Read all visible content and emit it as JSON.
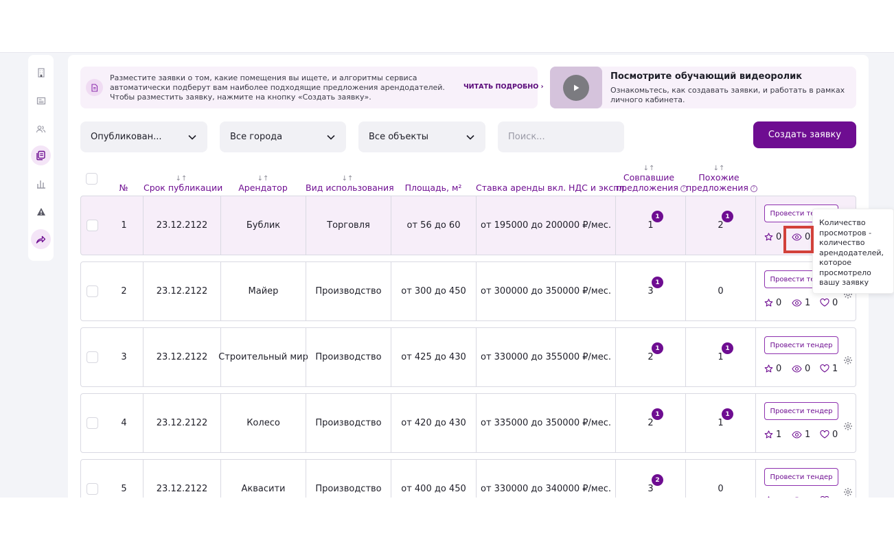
{
  "banner": {
    "text": "Разместите заявки о том, какие помещения вы ищете, и алгоритмы сервиса автоматически подберут вам наиболее подходящие предложения арендодателей. Чтобы разместить заявку, нажмите на кнопку «Создать заявку».",
    "link": "ЧИТАТЬ ПОДРОБНО ›"
  },
  "video": {
    "title": "Посмотрите обучающий видеоролик",
    "description": "Ознакомьтесь, как создавать заявки, и работать в рамках личного кабинета."
  },
  "filters": {
    "status": "Опубликован...",
    "city": "Все города",
    "object": "Все объекты",
    "search_placeholder": "Поиск...",
    "create_label": "Создать заявку"
  },
  "table": {
    "headers": {
      "num": "№",
      "period": "Срок публикации",
      "tenant": "Арендатор",
      "usage": "Вид использования",
      "area": "Площадь, м²",
      "rate": "Ставка аренды вкл. НДС и экспл.",
      "matched_1": "Совпавшие",
      "matched_2": "предложения",
      "similar_1": "Похожие",
      "similar_2": "предложения"
    },
    "sort_glyph": "↓↑",
    "help_glyph": "?",
    "tender_label": "Провести тендер",
    "rows": [
      {
        "num": "1",
        "date": "23.12.2122",
        "tenant": "Бублик",
        "usage": "Торговля",
        "area": "от 56 до 60",
        "rate": "от 195000 до 200000 ₽/мес.",
        "matched": "1",
        "matched_badge": "1",
        "similar": "2",
        "similar_badge": "1",
        "stars": "0",
        "views": "0",
        "likes": ""
      },
      {
        "num": "2",
        "date": "23.12.2122",
        "tenant": "Майер",
        "usage": "Производство",
        "area": "от 300 до 450",
        "rate": "от 300000 до 350000 ₽/мес.",
        "matched": "3",
        "matched_badge": "1",
        "similar": "0",
        "similar_badge": "",
        "stars": "0",
        "views": "1",
        "likes": "0"
      },
      {
        "num": "3",
        "date": "23.12.2122",
        "tenant": "Строительный мир",
        "usage": "Производство",
        "area": "от 425 до 430",
        "rate": "от 330000 до 355000 ₽/мес.",
        "matched": "2",
        "matched_badge": "1",
        "similar": "1",
        "similar_badge": "1",
        "stars": "0",
        "views": "0",
        "likes": "1"
      },
      {
        "num": "4",
        "date": "23.12.2122",
        "tenant": "Колесо",
        "usage": "Производство",
        "area": "от 420 до 430",
        "rate": "от 335000 до 350000 ₽/мес.",
        "matched": "2",
        "matched_badge": "1",
        "similar": "1",
        "similar_badge": "1",
        "stars": "1",
        "views": "1",
        "likes": "0"
      },
      {
        "num": "5",
        "date": "23.12.2122",
        "tenant": "Аквасити",
        "usage": "Производство",
        "area": "от 400 до 450",
        "rate": "от 330000 до 340000 ₽/мес.",
        "matched": "3",
        "matched_badge": "2",
        "similar": "0",
        "similar_badge": "",
        "stars": "",
        "views": "",
        "likes": ""
      }
    ]
  },
  "tooltip": {
    "text": "Количество просмотров - количество арендодателей, которое просмотрело вашу заявку"
  },
  "colors": {
    "accent": "#6e0d91",
    "highlight_row": "#f7eef9",
    "focus_outline": "#d2413a"
  },
  "icons": {
    "sidebar": [
      "building-icon",
      "newspaper-icon",
      "users-icon",
      "documents-icon",
      "bar-chart-icon",
      "warning-icon",
      "share-icon"
    ],
    "row_stats": [
      "star-icon",
      "eye-icon",
      "heart-icon"
    ]
  }
}
